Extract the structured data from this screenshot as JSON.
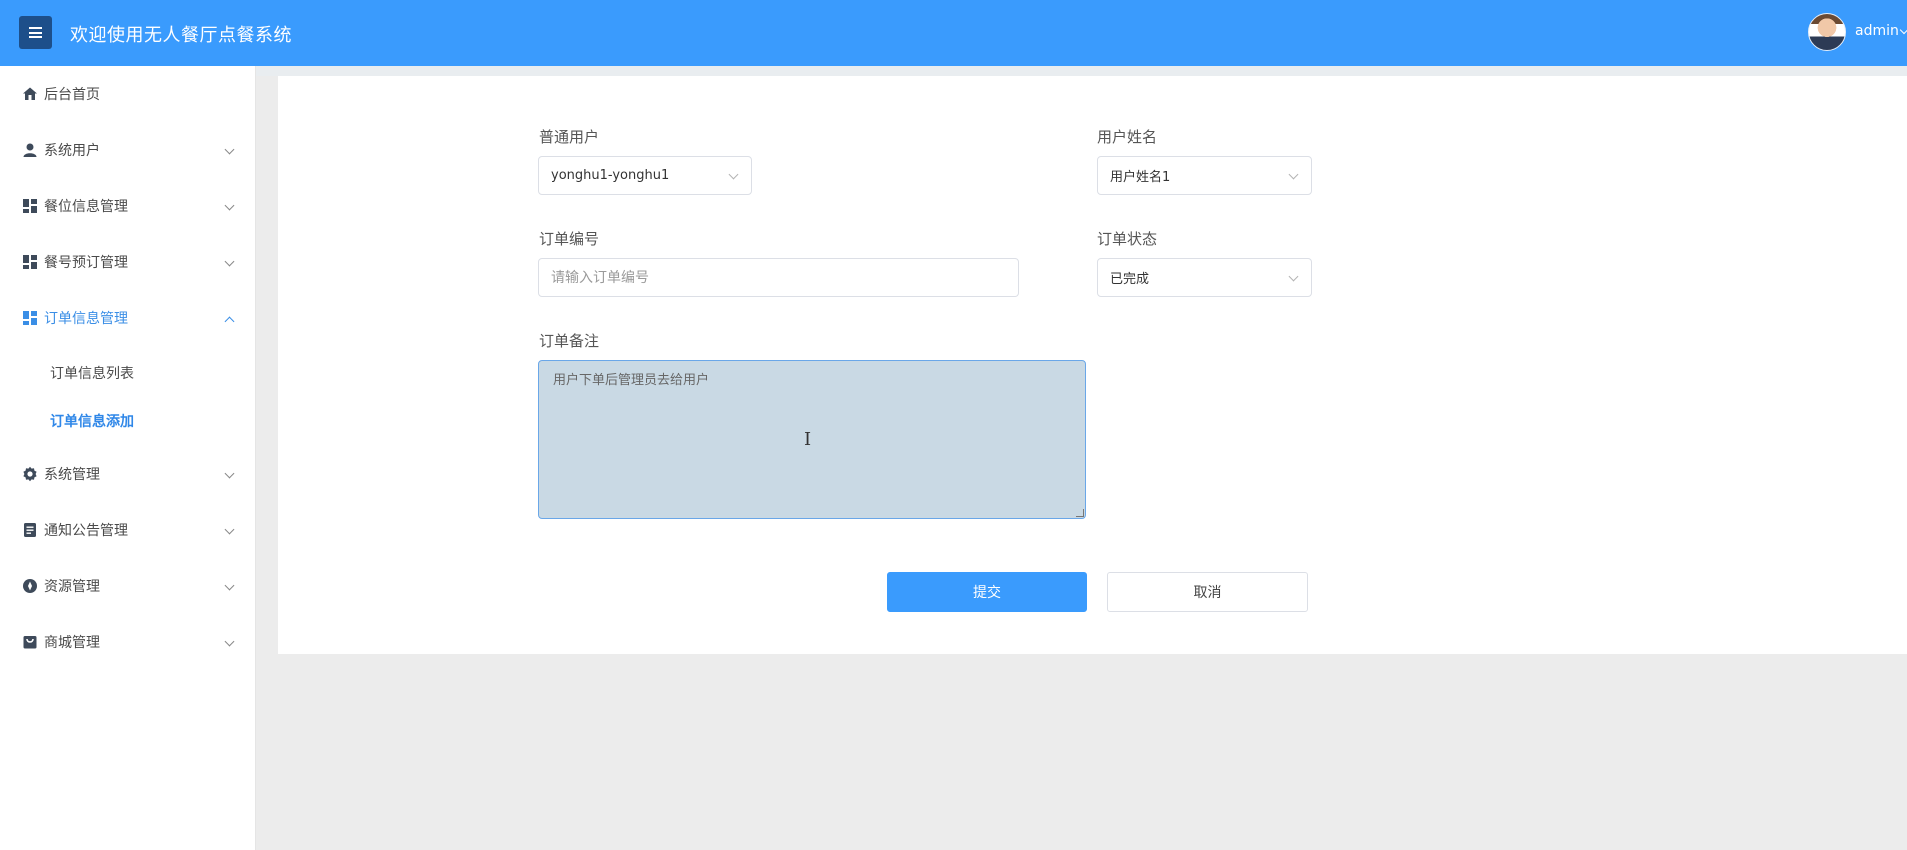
{
  "header": {
    "title": "欢迎使用无人餐厅点餐系统",
    "user_name": "admin",
    "menu_icon": "hamburger-menu-icon",
    "avatar_icon": "user-avatar"
  },
  "sidebar": {
    "items": [
      {
        "label": "后台首页",
        "icon": "home-icon",
        "expandable": false
      },
      {
        "label": "系统用户",
        "icon": "user-icon",
        "expandable": true
      },
      {
        "label": "餐位信息管理",
        "icon": "dashboard-icon",
        "expandable": true
      },
      {
        "label": "餐号预订管理",
        "icon": "dashboard-icon",
        "expandable": true
      },
      {
        "label": "订单信息管理",
        "icon": "dashboard-icon",
        "expandable": true,
        "expanded": true,
        "active": true
      },
      {
        "label": "系统管理",
        "icon": "gear-icon",
        "expandable": true
      },
      {
        "label": "通知公告管理",
        "icon": "document-icon",
        "expandable": true
      },
      {
        "label": "资源管理",
        "icon": "compass-icon",
        "expandable": true
      },
      {
        "label": "商城管理",
        "icon": "bag-icon",
        "expandable": true
      }
    ],
    "sub_items": [
      {
        "label": "订单信息列表",
        "active": false
      },
      {
        "label": "订单信息添加",
        "active": true
      }
    ]
  },
  "form": {
    "user_label": "普通用户",
    "user_value": "yonghu1-yonghu1",
    "name_label": "用户姓名",
    "name_value": "用户姓名1",
    "order_no_label": "订单编号",
    "order_no_placeholder": "请输入订单编号",
    "status_label": "订单状态",
    "status_value": "已完成",
    "remark_label": "订单备注",
    "remark_value": "用户下单后管理员去给用户",
    "submit_label": "提交",
    "cancel_label": "取消"
  },
  "colors": {
    "header_bg": "#3a9bfd",
    "active_text": "#2f87e8",
    "primary_button": "#3a9bfd",
    "textarea_bg": "#c9d9e4"
  }
}
